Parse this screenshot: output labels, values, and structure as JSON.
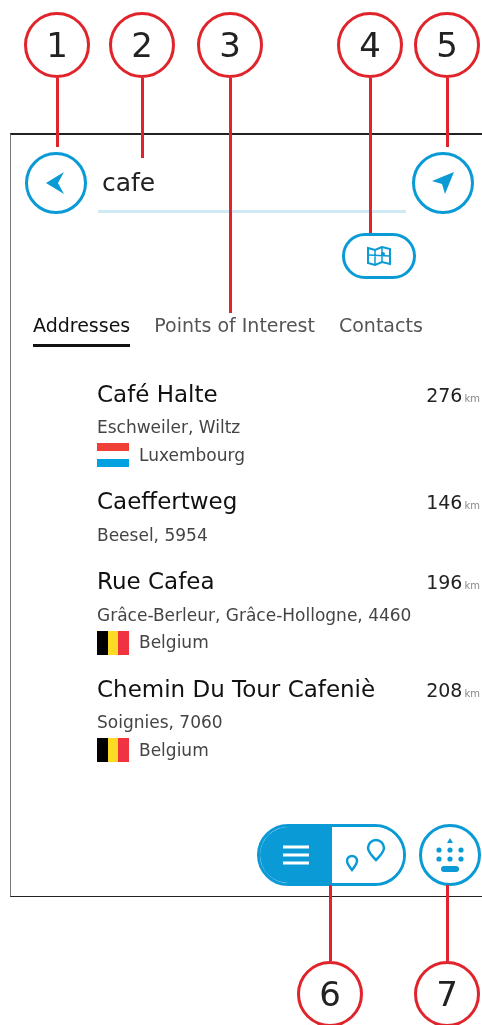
{
  "callouts_top": [
    {
      "number": "1"
    },
    {
      "number": "2"
    },
    {
      "number": "3"
    },
    {
      "number": "4"
    },
    {
      "number": "5"
    }
  ],
  "search": {
    "value": "cafe"
  },
  "tabs": [
    {
      "label": "Addresses",
      "selected": true
    },
    {
      "label": "Points of Interest",
      "selected": false
    },
    {
      "label": "Contacts",
      "selected": false
    }
  ],
  "results": [
    {
      "name": "Café Halte",
      "distance": "276",
      "unit": "km",
      "address": "Eschweiler, Wiltz",
      "country": "Luxembourg",
      "flag": {
        "kind": "horizontal",
        "stripes": [
          {
            "color": "#ef4135"
          },
          {
            "color": "#ffffff"
          },
          {
            "color": "#00a1de"
          }
        ]
      }
    },
    {
      "name": "Caeffertweg",
      "distance": "146",
      "unit": "km",
      "address": "Beesel, 5954"
    },
    {
      "name": "Rue Cafea",
      "distance": "196",
      "unit": "km",
      "address": "Grâce-Berleur, Grâce-Hollogne, 4460",
      "country": "Belgium",
      "flag": {
        "kind": "vertical",
        "stripes": [
          {
            "color": "#000000"
          },
          {
            "color": "#fdda24"
          },
          {
            "color": "#ef3340"
          }
        ]
      }
    },
    {
      "name": "Chemin Du Tour Cafeniè",
      "distance": "208",
      "unit": "km",
      "address": "Soignies, 7060",
      "country": "Belgium",
      "flag": {
        "kind": "vertical",
        "stripes": [
          {
            "color": "#000000"
          },
          {
            "color": "#fdda24"
          },
          {
            "color": "#ef3340"
          }
        ]
      }
    }
  ],
  "view_toggle": [
    {
      "kind": "list",
      "selected": true
    },
    {
      "kind": "map",
      "selected": false
    }
  ],
  "callouts_bottom": [
    {
      "number": "6"
    },
    {
      "number": "7"
    }
  ]
}
